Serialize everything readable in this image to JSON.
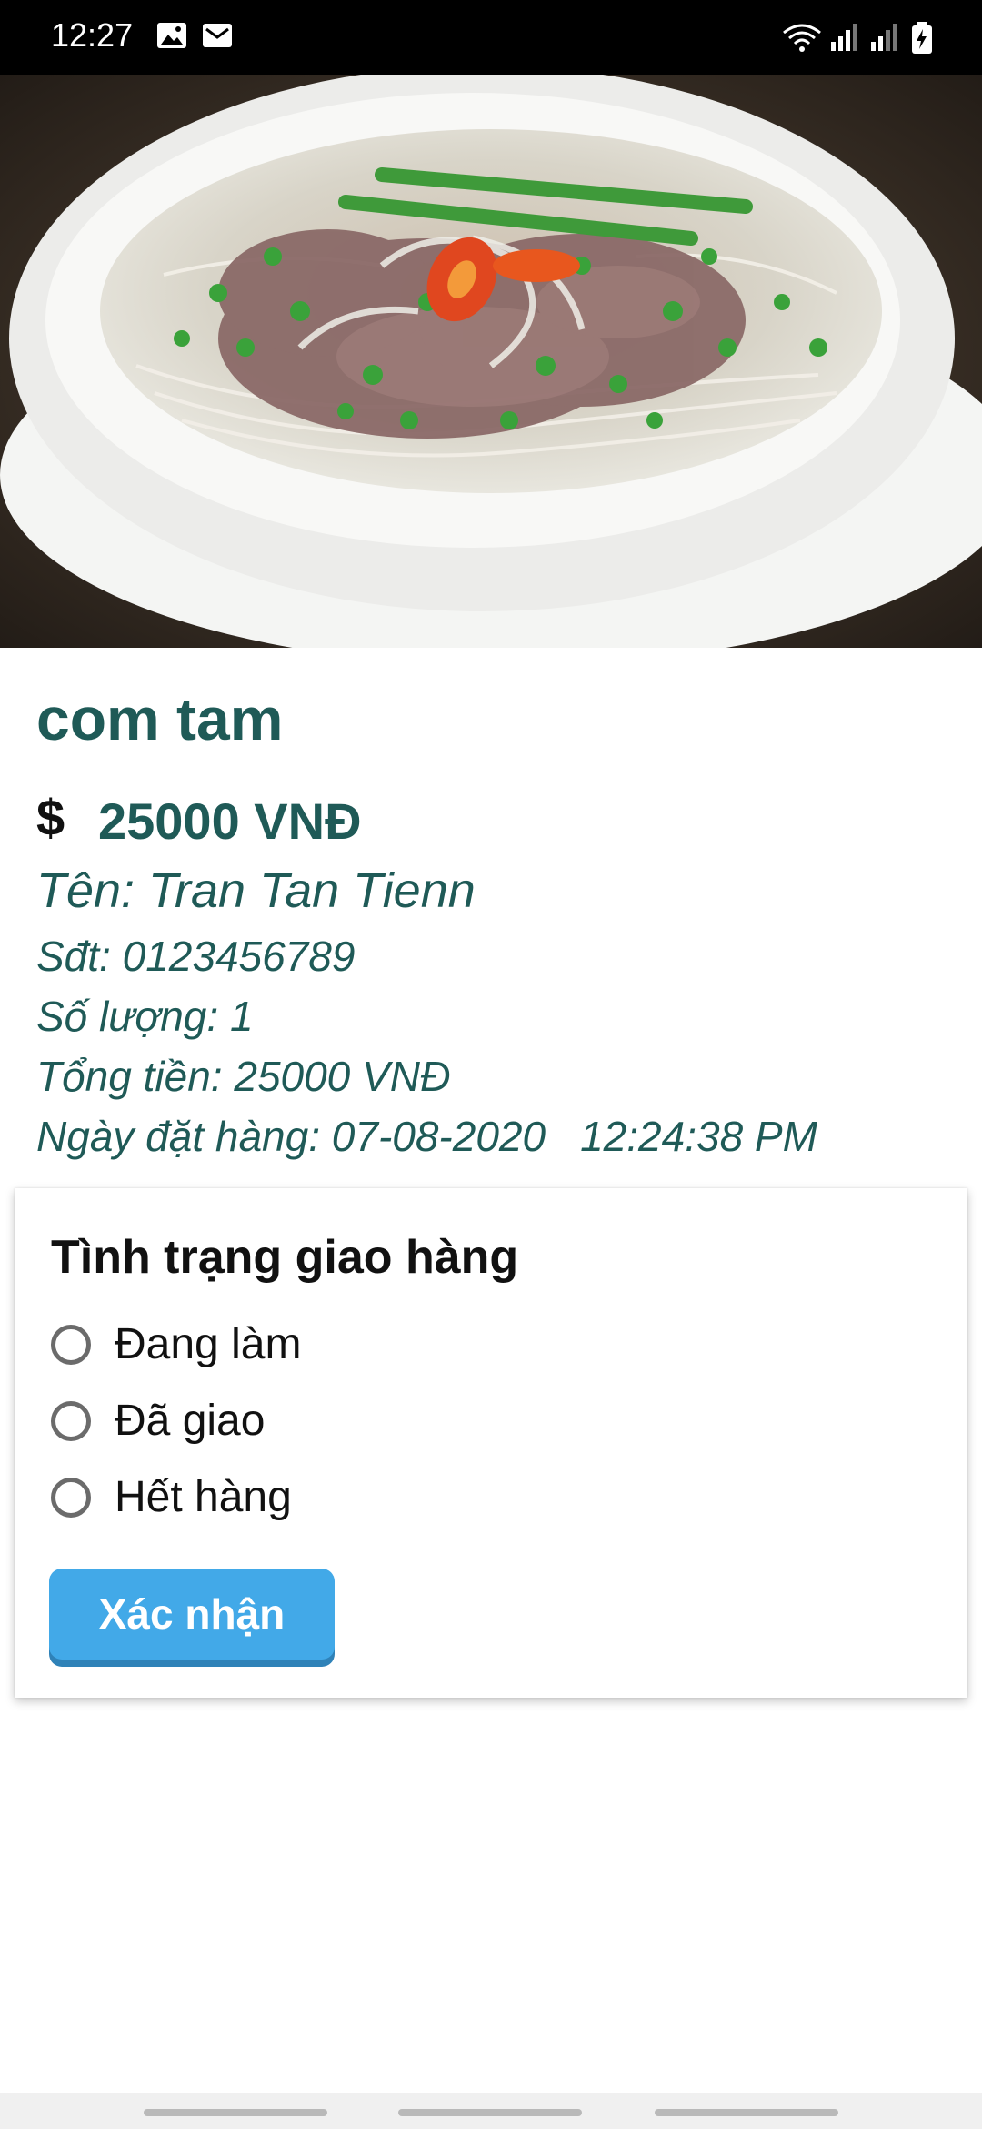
{
  "status_bar": {
    "time": "12:27",
    "left_icons": [
      "image-icon",
      "mail-icon"
    ],
    "right_icons": [
      "wifi-icon",
      "signal-icon",
      "signal-icon",
      "battery-charging-icon"
    ]
  },
  "hero_image": {
    "description_icon": "noodle-soup-photo"
  },
  "dish": {
    "name": "com tam",
    "currency_icon": "$",
    "price": "25000 VNĐ"
  },
  "order": {
    "name": "Tên: Tran Tan Tienn",
    "phone": "Sđt: 0123456789",
    "quantity": "Số lượng: 1",
    "total": "Tổng tiền: 25000 VNĐ",
    "date": "Ngày đặt hàng: 07-08-2020",
    "time": "12:24:38 PM"
  },
  "delivery_status": {
    "title": "Tình trạng giao hàng",
    "options": [
      "Đang làm",
      "Đã giao",
      "Hết hàng"
    ],
    "selected": null
  },
  "confirm_button": {
    "label": "Xác nhận"
  },
  "colors": {
    "accent_text": "#1f5a57",
    "button": "#42a9e8",
    "status_bar": "#000000"
  }
}
